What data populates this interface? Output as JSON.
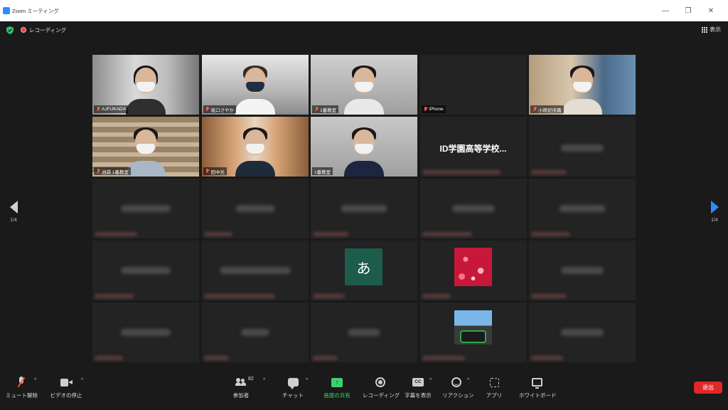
{
  "window": {
    "title": "Zoom ミーティング",
    "controls": [
      "—",
      "❐",
      "✕"
    ]
  },
  "status": {
    "recording_label": "レコーディング",
    "view_label": "表示"
  },
  "pagination": {
    "left": "1/4",
    "right": "1/4"
  },
  "tiles": [
    {
      "name": "AJFUKADA",
      "type": "video",
      "active": true
    },
    {
      "name": "坂口さやか",
      "type": "video"
    },
    {
      "name": "1番教室",
      "type": "video"
    },
    {
      "name": "iPhone",
      "type": "blank"
    },
    {
      "name": "小原妃佳織",
      "type": "video"
    },
    {
      "name": "池袋 1番教室",
      "type": "video"
    },
    {
      "name": "田中光",
      "type": "video"
    },
    {
      "name": "1番教室",
      "type": "video"
    },
    {
      "name": "ID学園高等学校...",
      "type": "text"
    },
    {
      "name": "",
      "type": "blurred"
    }
  ],
  "avatar_letter": "あ",
  "toolbar": {
    "unmute": "ミュート解除",
    "stop_video": "ビデオの停止",
    "participants": "参加者",
    "participants_count": "82",
    "chat": "チャット",
    "share_screen": "画面の共有",
    "share_icon": "↑",
    "record": "レコーディング",
    "captions": "字幕を表示",
    "captions_icon": "CC",
    "reactions": "リアクション",
    "apps": "アプリ",
    "whiteboard": "ホワイトボード",
    "leave": "退出",
    "caret": "^"
  },
  "colors": {
    "accent": "#2d8cff",
    "active_speaker": "#b8e35a",
    "share_green": "#3dd16d",
    "leave_red": "#e02828"
  }
}
